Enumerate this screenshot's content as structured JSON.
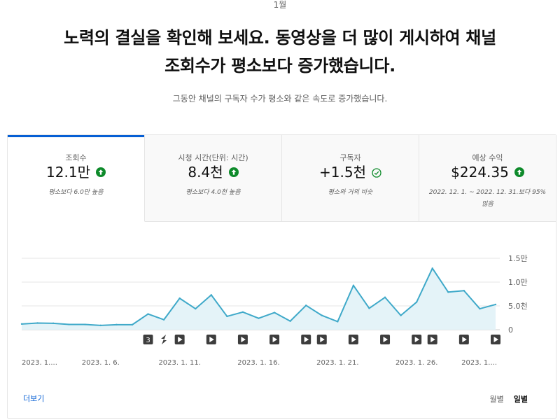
{
  "header": {
    "month": "1월",
    "headline_line1": "노력의 결실을 확인해 보세요. 동영상을 더 많이 게시하여 채널",
    "headline_line2": "조회수가 평소보다 증가했습니다.",
    "subline": "그동안 채널의 구독자 수가 평소와 같은 속도로 증가했습니다."
  },
  "tabs": [
    {
      "label": "조회수",
      "value": "12.1만",
      "note": "평소보다 6.0만 높음",
      "status_icon": "arrow-up-icon",
      "active": true
    },
    {
      "label": "시청 시간(단위: 시간)",
      "value": "8.4천",
      "note": "평소보다 4.0천 높음",
      "status_icon": "arrow-up-icon",
      "active": false
    },
    {
      "label": "구독자",
      "value": "+1.5천",
      "note": "평소와 거의 비슷",
      "status_icon": "check-circle-icon",
      "active": false
    },
    {
      "label": "예상 수익",
      "value": "$224.35",
      "note": "2022. 12. 1. ~ 2022. 12. 31.보다 95% 많음",
      "status_icon": "arrow-up-icon",
      "active": false
    }
  ],
  "colors": {
    "accent": "#065fd4",
    "line": "#3fa9c9",
    "fill": "#e4f3f8",
    "up": "#0d8a2a"
  },
  "chart_data": {
    "type": "area",
    "x": [
      "2023. 1. 1.",
      "2023. 1. 2.",
      "2023. 1. 3.",
      "2023. 1. 4.",
      "2023. 1. 5.",
      "2023. 1. 6.",
      "2023. 1. 7.",
      "2023. 1. 8.",
      "2023. 1. 9.",
      "2023. 1. 10.",
      "2023. 1. 11.",
      "2023. 1. 12.",
      "2023. 1. 13.",
      "2023. 1. 14.",
      "2023. 1. 15.",
      "2023. 1. 16.",
      "2023. 1. 17.",
      "2023. 1. 18.",
      "2023. 1. 19.",
      "2023. 1. 20.",
      "2023. 1. 21.",
      "2023. 1. 22.",
      "2023. 1. 23.",
      "2023. 1. 24.",
      "2023. 1. 25.",
      "2023. 1. 26.",
      "2023. 1. 27.",
      "2023. 1. 28.",
      "2023. 1. 29.",
      "2023. 1. 30."
    ],
    "values": [
      1200,
      1400,
      1350,
      1100,
      1100,
      900,
      1050,
      1050,
      3300,
      2100,
      6600,
      4400,
      7300,
      2800,
      3700,
      2400,
      3600,
      1800,
      5100,
      3000,
      1700,
      9300,
      4500,
      6800,
      3000,
      5800,
      12900,
      7900,
      8200,
      4400
    ],
    "last_value": 5300,
    "ylim": [
      0,
      15000
    ],
    "y_ticks": [
      0,
      5000,
      10000,
      15000
    ],
    "y_tick_labels": [
      "0",
      "5.0천",
      "1.0만",
      "1.5만"
    ],
    "x_tick_labels": [
      "2023. 1....",
      "2023. 1. 6.",
      "2023. 1. 11.",
      "2023. 1. 16.",
      "2023. 1. 21.",
      "2023. 1. 26.",
      "2023. 1...."
    ],
    "x_tick_index": [
      0,
      5,
      10,
      15,
      20,
      25,
      29
    ],
    "markers": [
      {
        "day_index": 8,
        "kind": "count",
        "label": "3"
      },
      {
        "day_index": 9,
        "kind": "short",
        "label": ""
      },
      {
        "day_index": 10,
        "kind": "video",
        "label": ""
      },
      {
        "day_index": 12,
        "kind": "video",
        "label": ""
      },
      {
        "day_index": 14,
        "kind": "video",
        "label": ""
      },
      {
        "day_index": 16,
        "kind": "video",
        "label": ""
      },
      {
        "day_index": 18,
        "kind": "video",
        "label": ""
      },
      {
        "day_index": 19,
        "kind": "video",
        "label": ""
      },
      {
        "day_index": 21,
        "kind": "video",
        "label": ""
      },
      {
        "day_index": 23,
        "kind": "video",
        "label": ""
      },
      {
        "day_index": 25,
        "kind": "video",
        "label": ""
      },
      {
        "day_index": 26,
        "kind": "video",
        "label": ""
      },
      {
        "day_index": 28,
        "kind": "video",
        "label": ""
      },
      {
        "day_index": 30,
        "kind": "video",
        "label": ""
      }
    ],
    "grid": true
  },
  "footer": {
    "more_label": "더보기",
    "monthly_label": "월별",
    "daily_label": "일별"
  }
}
